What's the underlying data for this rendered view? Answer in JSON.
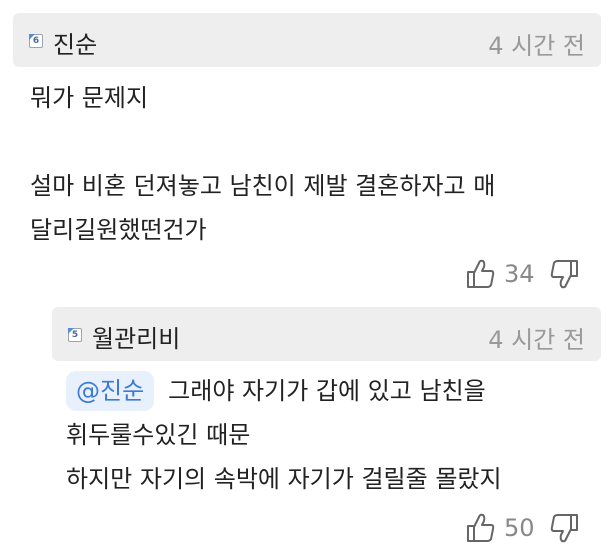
{
  "comment": {
    "level_badge": "6",
    "author": "진순",
    "time": "4 시간 전",
    "lines": [
      "뭐가 문제지",
      "",
      "설마 비혼 던져놓고 남친이 제발 결혼하자고 매",
      "달리길원했떤건가"
    ],
    "likes": "34"
  },
  "reply": {
    "level_badge": "5",
    "author": "월관리비",
    "time": "4 시간 전",
    "mention": "@진순",
    "first_line_text": "그래야 자기가 갑에 있고 남친을",
    "lines": [
      "휘두룰수있긴 때문",
      "하지만 자기의 속박에 자기가 걸릴줄 몰랐지"
    ],
    "likes": "50"
  },
  "icons": {
    "like": "thumbs-up-icon",
    "dislike": "thumbs-down-icon",
    "level": "level-badge-icon"
  },
  "colors": {
    "header_bg": "#eeeeee",
    "mention_bg": "#e7f0fb",
    "mention_text": "#3b7bd6",
    "muted": "#888888"
  }
}
